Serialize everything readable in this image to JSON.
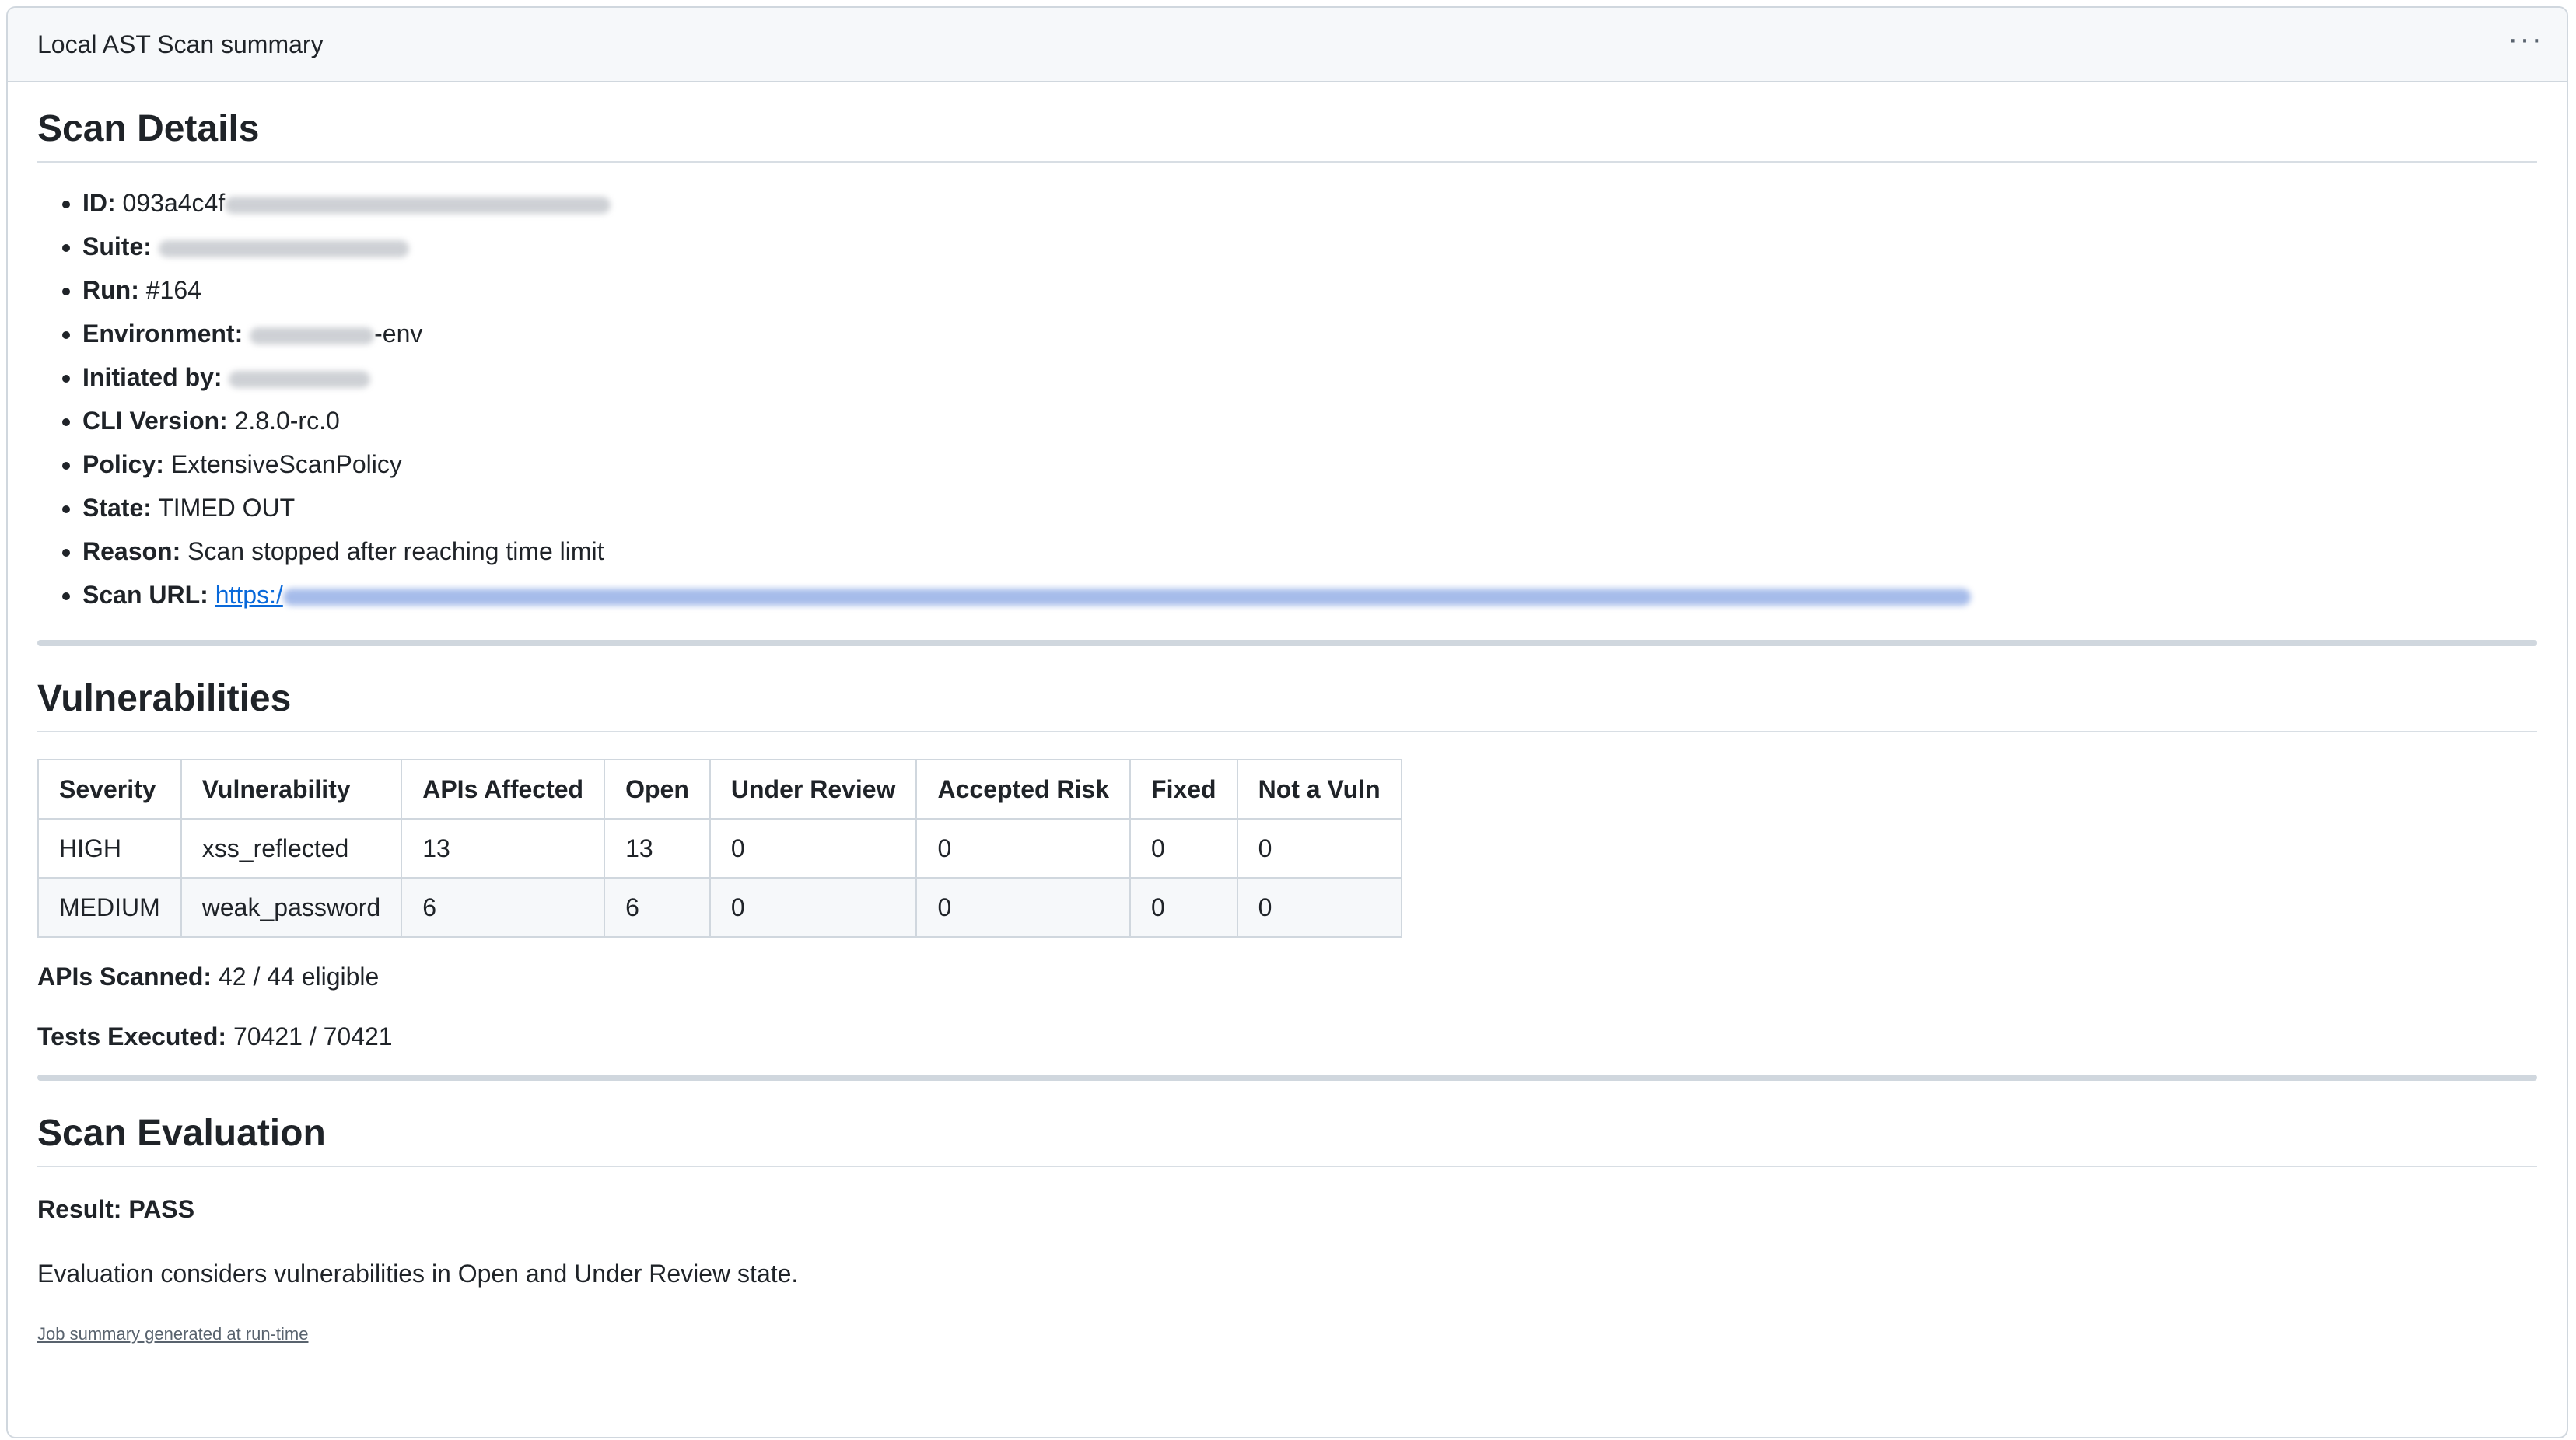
{
  "header": {
    "title": "Local AST Scan summary",
    "menu_label": "···"
  },
  "scan_details": {
    "heading": "Scan Details",
    "items": [
      {
        "label": "ID:",
        "value": "093a4c4f"
      },
      {
        "label": "Suite:",
        "value": ""
      },
      {
        "label": "Run:",
        "value": "#164"
      },
      {
        "label": "Environment:",
        "value": "-env"
      },
      {
        "label": "Initiated by:",
        "value": ""
      },
      {
        "label": "CLI Version:",
        "value": "2.8.0-rc.0"
      },
      {
        "label": "Policy:",
        "value": "ExtensiveScanPolicy"
      },
      {
        "label": "State:",
        "value": "TIMED OUT"
      },
      {
        "label": "Reason:",
        "value": "Scan stopped after reaching time limit"
      },
      {
        "label": "Scan URL:",
        "value": "https:/"
      }
    ]
  },
  "vulnerabilities": {
    "heading": "Vulnerabilities",
    "columns": [
      "Severity",
      "Vulnerability",
      "APIs Affected",
      "Open",
      "Under Review",
      "Accepted Risk",
      "Fixed",
      "Not a Vuln"
    ],
    "rows": [
      [
        "HIGH",
        "xss_reflected",
        "13",
        "13",
        "0",
        "0",
        "0",
        "0"
      ],
      [
        "MEDIUM",
        "weak_password",
        "6",
        "6",
        "0",
        "0",
        "0",
        "0"
      ]
    ],
    "apis_scanned_label": "APIs Scanned:",
    "apis_scanned_value": "42 / 44 eligible",
    "tests_executed_label": "Tests Executed:",
    "tests_executed_value": "70421 / 70421"
  },
  "evaluation": {
    "heading": "Scan Evaluation",
    "result": "Result: PASS",
    "note": "Evaluation considers vulnerabilities in Open and Under Review state."
  },
  "footer": {
    "link_text": "Job summary generated at run-time"
  }
}
